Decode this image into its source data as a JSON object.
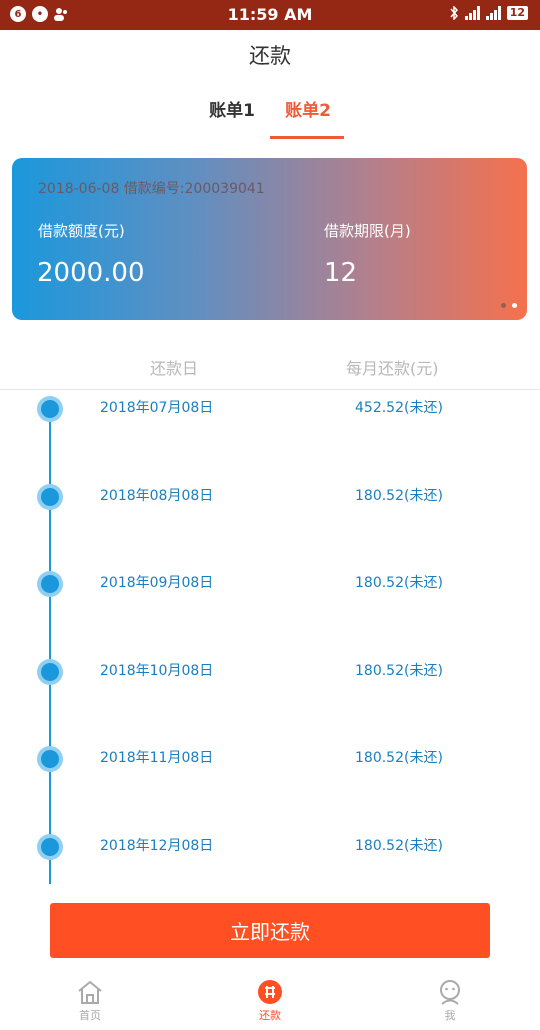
{
  "status_bar": {
    "time": "11:59 AM",
    "notif_badge": "6",
    "battery": "12"
  },
  "page": {
    "title": "还款"
  },
  "tabs": [
    {
      "label": "账单1",
      "active": false
    },
    {
      "label": "账单2",
      "active": true
    }
  ],
  "card": {
    "meta": "2018-06-08  借款编号:200039041",
    "amount_label": "借款额度(元)",
    "amount_value": "2000.00",
    "term_label": "借款期限(月)",
    "term_value": "12"
  },
  "schedule": {
    "date_header": "还款日",
    "amount_header": "每月还款(元)",
    "rows": [
      {
        "date": "2018年07月08日",
        "amount": "452.52(未还)"
      },
      {
        "date": "2018年08月08日",
        "amount": "180.52(未还)"
      },
      {
        "date": "2018年09月08日",
        "amount": "180.52(未还)"
      },
      {
        "date": "2018年10月08日",
        "amount": "180.52(未还)"
      },
      {
        "date": "2018年11月08日",
        "amount": "180.52(未还)"
      },
      {
        "date": "2018年12月08日",
        "amount": "180.52(未还)"
      }
    ]
  },
  "action": {
    "pay_label": "立即还款"
  },
  "nav": {
    "home": "首页",
    "repay": "还款",
    "me": "我"
  },
  "colors": {
    "accent": "#ff4f23",
    "blue": "#1b98dc",
    "status": "#952815"
  }
}
